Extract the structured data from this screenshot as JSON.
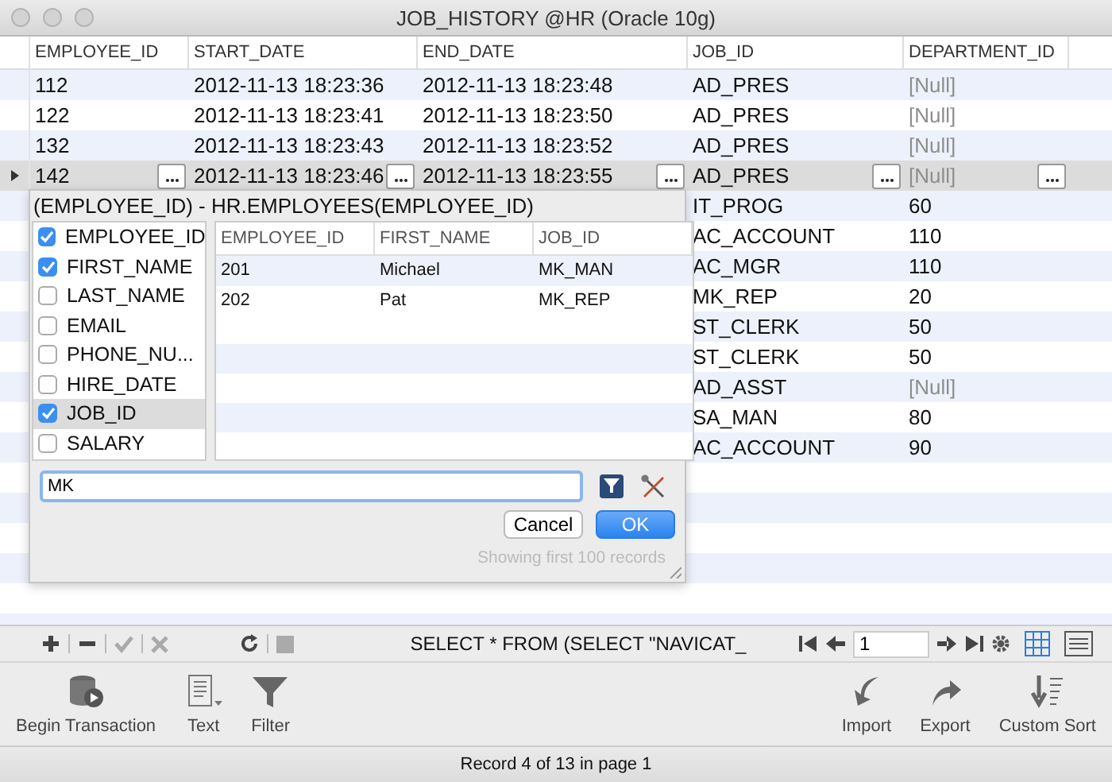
{
  "window": {
    "title": "JOB_HISTORY @HR (Oracle 10g)"
  },
  "grid": {
    "columns": [
      "EMPLOYEE_ID",
      "START_DATE",
      "END_DATE",
      "JOB_ID",
      "DEPARTMENT_ID"
    ],
    "rows": [
      {
        "employee_id": "112",
        "start_date": "2012-11-13 18:23:36",
        "end_date": "2012-11-13 18:23:48",
        "job_id": "AD_PRES",
        "department_id": "[Null]",
        "department_null": true,
        "selected": false
      },
      {
        "employee_id": "122",
        "start_date": "2012-11-13 18:23:41",
        "end_date": "2012-11-13 18:23:50",
        "job_id": "AD_PRES",
        "department_id": "[Null]",
        "department_null": true,
        "selected": false
      },
      {
        "employee_id": "132",
        "start_date": "2012-11-13 18:23:43",
        "end_date": "2012-11-13 18:23:52",
        "job_id": "AD_PRES",
        "department_id": "[Null]",
        "department_null": true,
        "selected": false
      },
      {
        "employee_id": "142",
        "start_date": "2012-11-13 18:23:46",
        "end_date": "2012-11-13 18:23:55",
        "job_id": "AD_PRES",
        "department_id": "[Null]",
        "department_null": true,
        "selected": true
      },
      {
        "job_id": "IT_PROG",
        "department_id": "60",
        "department_null": false,
        "selected": false
      },
      {
        "job_id": "AC_ACCOUNT",
        "department_id": "110",
        "department_null": false,
        "selected": false
      },
      {
        "job_id": "AC_MGR",
        "department_id": "110",
        "department_null": false,
        "selected": false
      },
      {
        "job_id": "MK_REP",
        "department_id": "20",
        "department_null": false,
        "selected": false
      },
      {
        "job_id": "ST_CLERK",
        "department_id": "50",
        "department_null": false,
        "selected": false
      },
      {
        "job_id": "ST_CLERK",
        "department_id": "50",
        "department_null": false,
        "selected": false
      },
      {
        "job_id": "AD_ASST",
        "department_id": "[Null]",
        "department_null": true,
        "selected": false
      },
      {
        "job_id": "SA_MAN",
        "department_id": "80",
        "department_null": false,
        "selected": false
      },
      {
        "job_id": "AC_ACCOUNT",
        "department_id": "90",
        "department_null": false,
        "selected": false
      }
    ]
  },
  "lookup": {
    "title": "(EMPLOYEE_ID) - HR.EMPLOYEES(EMPLOYEE_ID)",
    "fields": [
      {
        "label": "EMPLOYEE_ID",
        "checked": true,
        "selected": false
      },
      {
        "label": "FIRST_NAME",
        "checked": true,
        "selected": false
      },
      {
        "label": "LAST_NAME",
        "checked": false,
        "selected": false
      },
      {
        "label": "EMAIL",
        "checked": false,
        "selected": false
      },
      {
        "label": "PHONE_NU...",
        "checked": false,
        "selected": false
      },
      {
        "label": "HIRE_DATE",
        "checked": false,
        "selected": false
      },
      {
        "label": "JOB_ID",
        "checked": true,
        "selected": true
      },
      {
        "label": "SALARY",
        "checked": false,
        "selected": false
      }
    ],
    "columns": [
      "EMPLOYEE_ID",
      "FIRST_NAME",
      "JOB_ID"
    ],
    "rows": [
      [
        "201",
        "Michael",
        "MK_MAN"
      ],
      [
        "202",
        "Pat",
        "MK_REP"
      ]
    ],
    "search": {
      "value": "MK"
    },
    "buttons": [
      {
        "label": "Cancel",
        "kind": "cancel"
      },
      {
        "label": "OK",
        "kind": "default"
      }
    ],
    "note": "Showing first 100 records"
  },
  "query": "SELECT * FROM (SELECT \"NAVICAT_",
  "page_field": {
    "value": "1"
  },
  "view_modes": [
    {
      "kind": "grid",
      "selected": true
    },
    {
      "kind": "form",
      "selected": false
    }
  ],
  "toolbar": [
    {
      "label": "Begin Transaction",
      "kind": "transaction"
    },
    {
      "label": "Text",
      "kind": "text"
    },
    {
      "label": "Filter",
      "kind": "filter"
    },
    {
      "label": "Import",
      "kind": "import"
    },
    {
      "label": "Export",
      "kind": "export"
    },
    {
      "label": "Custom Sort",
      "kind": "sort"
    }
  ],
  "status_bar": "Record 4 of 13 in page 1"
}
